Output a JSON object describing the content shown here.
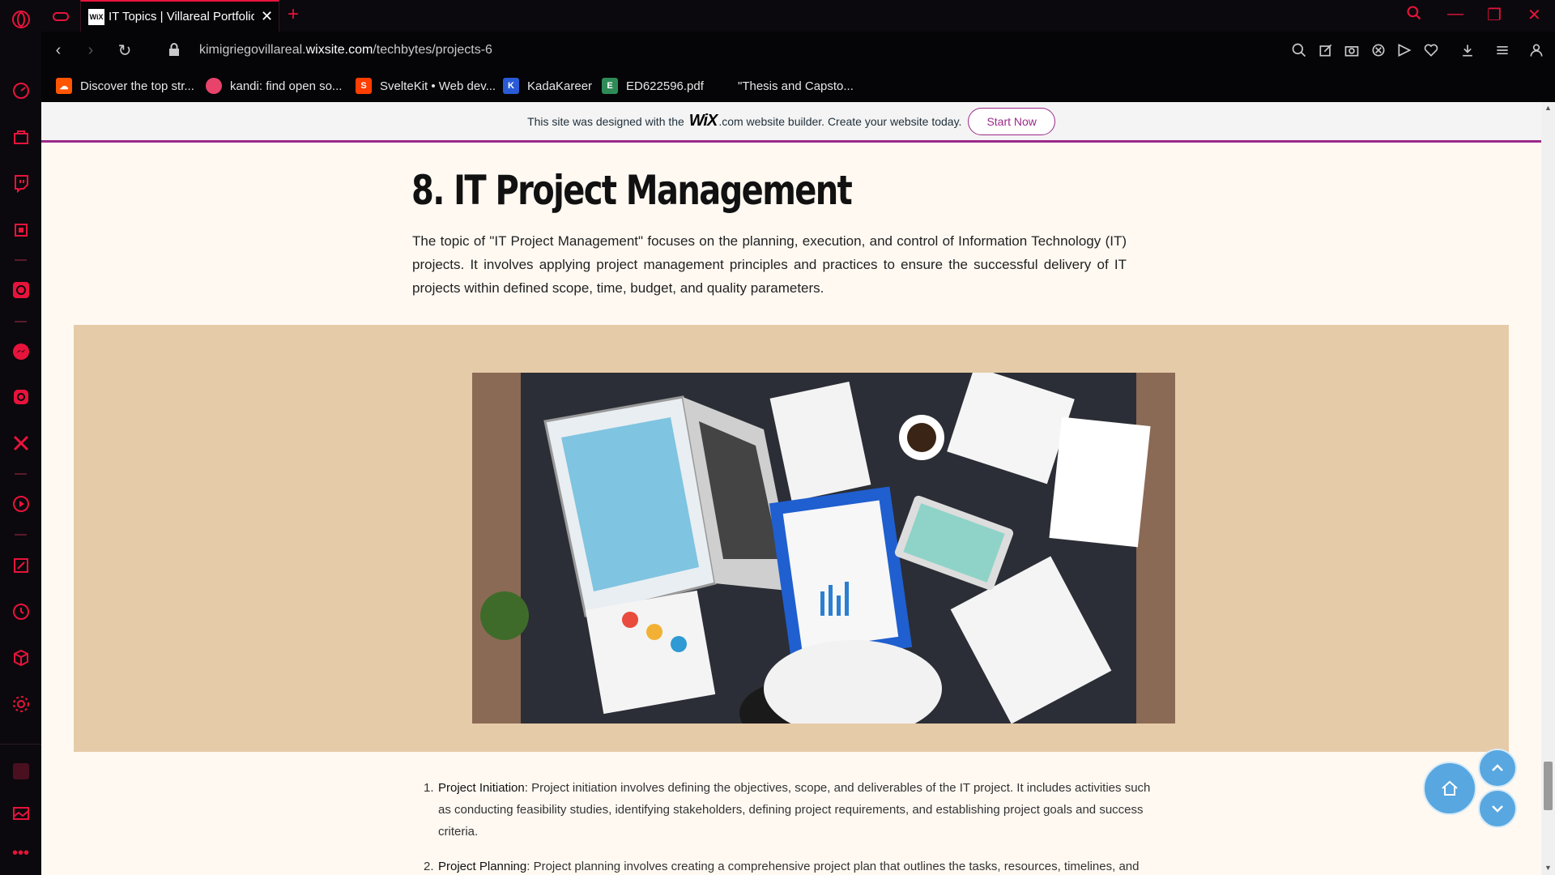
{
  "browser": {
    "accent_color": "#e8133c",
    "tab": {
      "favicon": "wix",
      "title": "IT Topics | Villareal Portfolio"
    },
    "address": {
      "url_prefix": "kimigriegovillareal.",
      "url_domain": "wixsite.com",
      "url_path": "/techbytes/projects-6"
    },
    "bookmarks": [
      {
        "label": "Discover the top str...",
        "icon": "soundcloud-icon",
        "color": "#ff5500"
      },
      {
        "label": "kandi: find open so...",
        "icon": "kandi-icon",
        "color": "#e8436b"
      },
      {
        "label": "SvelteKit • Web dev...",
        "icon": "svelte-icon",
        "color": "#ff3e00"
      },
      {
        "label": "KadaKareer",
        "icon": "kadakareer-icon",
        "color": "#2a5bd7"
      },
      {
        "label": "ED622596.pdf",
        "icon": "eric-icon",
        "color": "#2e8b57"
      },
      {
        "label": "\"Thesis and Capsto...",
        "icon": "",
        "color": ""
      }
    ]
  },
  "wix_banner": {
    "text_before": "This site was designed with the",
    "logo": "WiX",
    "text_after": ".com website builder. Create your website today.",
    "button": "Start Now"
  },
  "page": {
    "heading": "8. IT Project Management",
    "intro": "The topic of \"IT Project Management\" focuses on the planning, execution, and control of Information Technology (IT) projects. It involves applying project management principles and practices to ensure the successful delivery of IT projects within defined scope, time, budget, and quality parameters.",
    "image_alt": "Top-down view of people analyzing charts and reports on a desk with a laptop",
    "steps": [
      {
        "num": "1.",
        "title": "Project Initiation",
        "text": ": Project initiation involves defining the objectives, scope, and deliverables of the IT project. It includes activities such as conducting feasibility studies, identifying stakeholders, defining project requirements, and establishing project goals and success criteria."
      },
      {
        "num": "2.",
        "title": "Project Planning",
        "text": ": Project planning involves creating a comprehensive project plan that outlines the tasks, resources, timelines, and"
      }
    ]
  }
}
